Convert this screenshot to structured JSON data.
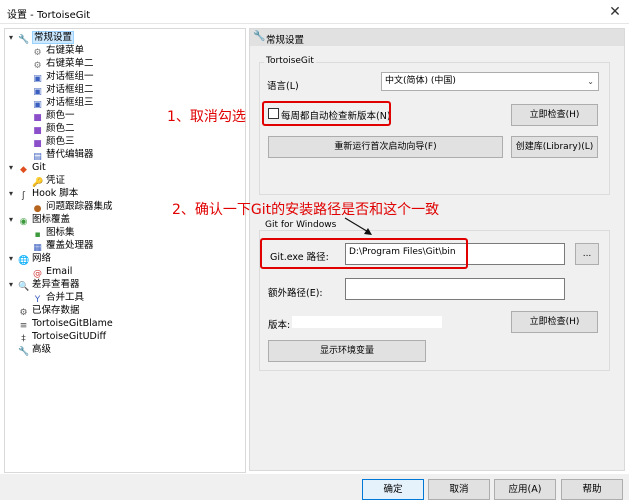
{
  "window": {
    "title": "设置 - TortoiseGit",
    "close_glyph": "✕"
  },
  "tree": {
    "items": [
      {
        "label": "常规设置",
        "icon": "wrench-icon"
      },
      {
        "label": "右键菜单",
        "icon": "gear-icon"
      },
      {
        "label": "右键菜单二",
        "icon": "gear-icon"
      },
      {
        "label": "对话框组一",
        "icon": "dialog-icon"
      },
      {
        "label": "对话框组二",
        "icon": "dialog-icon"
      },
      {
        "label": "对话框组三",
        "icon": "dialog-icon"
      },
      {
        "label": "颜色一",
        "icon": "palette-icon"
      },
      {
        "label": "颜色二",
        "icon": "palette-icon"
      },
      {
        "label": "颜色三",
        "icon": "palette-icon"
      },
      {
        "label": "替代编辑器",
        "icon": "editor-icon"
      },
      {
        "label": "Git",
        "icon": "git-icon"
      },
      {
        "label": "凭证",
        "icon": "credential-icon"
      },
      {
        "label": "Hook 脚本",
        "icon": "hook-icon"
      },
      {
        "label": "问题跟踪器集成",
        "icon": "bug-icon"
      },
      {
        "label": "图标覆盖",
        "icon": "overlay-icon"
      },
      {
        "label": "图标集",
        "icon": "iconset-icon"
      },
      {
        "label": "覆盖处理器",
        "icon": "handler-icon"
      },
      {
        "label": "网络",
        "icon": "network-icon"
      },
      {
        "label": "Email",
        "icon": "email-icon"
      },
      {
        "label": "差异查看器",
        "icon": "diff-icon"
      },
      {
        "label": "合并工具",
        "icon": "merge-icon"
      },
      {
        "label": "已保存数据",
        "icon": "saved-data-icon"
      },
      {
        "label": "TortoiseGitBlame",
        "icon": "blame-icon"
      },
      {
        "label": "TortoiseGitUDiff",
        "icon": "udiff-icon"
      },
      {
        "label": "高级",
        "icon": "advanced-icon"
      }
    ]
  },
  "panel": {
    "header": "常规设置",
    "group1": {
      "title": "TortoiseGit",
      "language_label": "语言(L)",
      "language_value": "中文(简体) (中国)",
      "auto_check_label": "每周都自动检查新版本(N)",
      "auto_check_checked": false,
      "check_now_button": "立即检查(H)",
      "rerun_wizard_button": "重新运行首次启动向导(F)",
      "create_library_button": "创建库(Library)(L)"
    },
    "group2": {
      "title": "Git for Windows",
      "git_exe_label": "Git.exe 路径:",
      "git_exe_value": "D:\\Program Files\\Git\\bin",
      "browse_button": "...",
      "extra_path_label": "额外路径(E):",
      "extra_path_value": "",
      "version_label": "版本:",
      "version_value": "",
      "check_now_button": "立即检查(H)",
      "show_env_button": "显示环境变量"
    }
  },
  "annotations": {
    "step1": "1、取消勾选",
    "step2": "2、确认一下Git的安装路径是否和这个一致",
    "color": "#e00000"
  },
  "footer": {
    "ok": "确定",
    "cancel": "取消",
    "apply": "应用(A)",
    "help": "帮助"
  }
}
